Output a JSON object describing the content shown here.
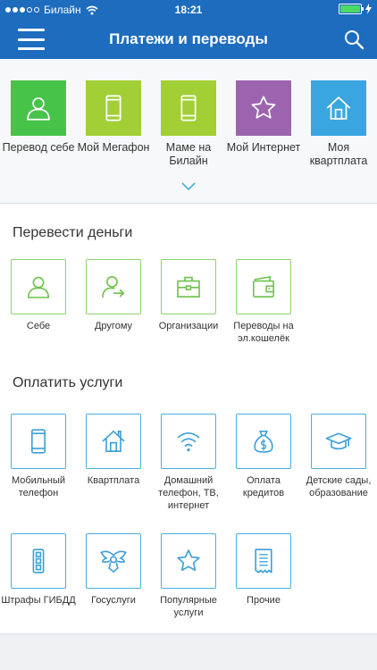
{
  "status_bar": {
    "carrier": "Билайн",
    "time": "18:21",
    "battery_level": 1.0,
    "colors": {
      "bar": "#1d6cbd",
      "battery": "#4cd964"
    }
  },
  "nav_bar": {
    "title": "Платежи и переводы",
    "menu_icon": "hamburger-menu-icon",
    "search_icon": "search-icon"
  },
  "quick_actions": [
    {
      "label": "Перевод себе",
      "icon": "person-icon",
      "color": "#48c34a"
    },
    {
      "label": "Мой Мегафон",
      "icon": "phone-icon",
      "color": "#a2cf36"
    },
    {
      "label": "Маме на Билайн",
      "icon": "phone-icon",
      "color": "#a2cf36"
    },
    {
      "label": "Мой Интернет",
      "icon": "star-icon",
      "color": "#9c64ae"
    },
    {
      "label": "Моя квартплата",
      "icon": "house-icon",
      "color": "#3aa6e0"
    }
  ],
  "transfer_section": {
    "title": "Перевести деньги",
    "items": [
      {
        "label": "Себе",
        "icon": "person-icon"
      },
      {
        "label": "Другому",
        "icon": "person-transfer-icon"
      },
      {
        "label": "Организации",
        "icon": "briefcase-icon"
      },
      {
        "label": "Переводы на эл.кошелёк",
        "icon": "wallet-icon"
      }
    ]
  },
  "pay_section": {
    "title": "Оплатить услуги",
    "items": [
      {
        "label": "Мобильный телефон",
        "icon": "phone-icon"
      },
      {
        "label": "Квартплата",
        "icon": "house-icon"
      },
      {
        "label": "Домашний телефон, ТВ, интернет",
        "icon": "wifi-icon"
      },
      {
        "label": "Оплата кредитов",
        "icon": "money-bag-icon"
      },
      {
        "label": "Детские сады, образование",
        "icon": "graduation-cap-icon"
      },
      {
        "label": "Штрафы ГИБДД",
        "icon": "traffic-light-icon"
      },
      {
        "label": "Госуслуги",
        "icon": "eagle-emblem-icon"
      },
      {
        "label": "Популярные услуги",
        "icon": "star-icon"
      },
      {
        "label": "Прочие",
        "icon": "receipt-icon"
      }
    ]
  },
  "theme": {
    "green_outline": "#8fd26d",
    "green_icon": "#6cc24a",
    "blue_outline": "#4aaede",
    "blue_icon": "#3a9fd8"
  }
}
